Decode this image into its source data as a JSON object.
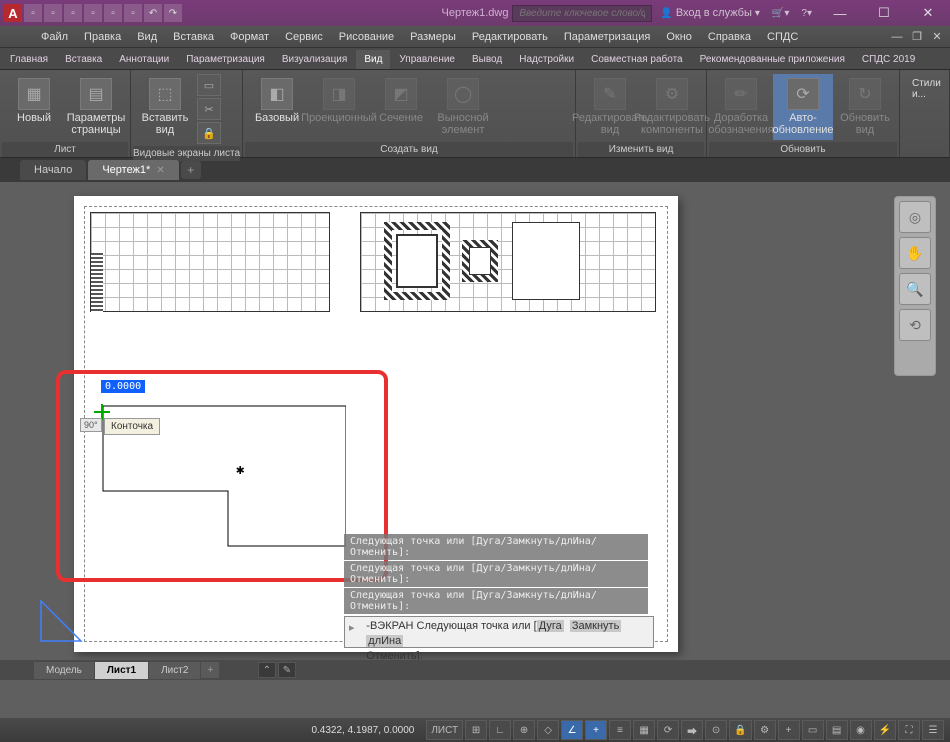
{
  "title": "Чертеж1.dwg",
  "search_placeholder": "Введите ключевое слово/фразу",
  "signin": "Вход в службы",
  "menubar": [
    "Файл",
    "Правка",
    "Вид",
    "Вставка",
    "Формат",
    "Сервис",
    "Рисование",
    "Размеры",
    "Редактировать",
    "Параметризация",
    "Окно",
    "Справка",
    "СПДС"
  ],
  "ribbon_tabs": [
    "Главная",
    "Вставка",
    "Аннотации",
    "Параметризация",
    "Визуализация",
    "Вид",
    "Управление",
    "Вывод",
    "Надстройки",
    "Совместная работа",
    "Рекомендованные приложения",
    "СПДС 2019"
  ],
  "active_ribbon_tab": 5,
  "ribbon": {
    "panel1": {
      "title": "Лист",
      "btn1": "Новый",
      "btn2": "Параметры\nстраницы"
    },
    "panel2": {
      "title": "Видовые экраны листа",
      "btn1": "Вставить вид"
    },
    "panel3": {
      "title": "Создать вид",
      "btn1": "Базовый",
      "btn2": "Проекционный",
      "btn3": "Сечение",
      "btn4": "Выносной элемент"
    },
    "panel4": {
      "title": "Изменить вид",
      "btn1": "Редактировать\nвид",
      "btn2": "Редактировать\nкомпоненты"
    },
    "panel5": {
      "title": "Обновить",
      "btn1": "Доработка\nобозначения",
      "btn2": "Авто-\nобновление",
      "btn3": "Обновить\nвид"
    },
    "styles": "Стили и..."
  },
  "filetabs": {
    "start": "Начало",
    "doc": "Чертеж1*"
  },
  "drawing": {
    "dim_value": "0.0000",
    "angle": "90°",
    "tooltip": "Конточка"
  },
  "cmd_history": [
    "Следующая точка или [Дуга/Замкнуть/длИна/Отменить]:",
    "Следующая точка или [Дуга/Замкнуть/длИна/Отменить]:",
    "Следующая точка или [Дуга/Замкнуть/длИна/Отменить]:"
  ],
  "cmd_input": {
    "prefix": "-ВЭКРАН Следующая точка или [",
    "opts": [
      "Дуга",
      "Замкнуть",
      "длИна"
    ],
    "suffix": "Отменить]:"
  },
  "layout_tabs": [
    "Модель",
    "Лист1",
    "Лист2"
  ],
  "active_layout": 1,
  "status": {
    "coords": "0.4322, 4.1987, 0.0000",
    "mode": "ЛИСТ"
  }
}
